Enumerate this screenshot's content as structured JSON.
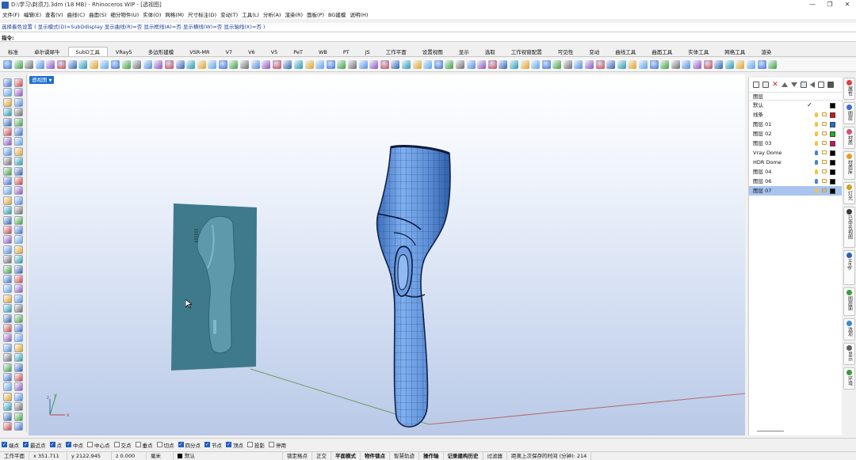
{
  "window": {
    "title": "D:\\学习\\剃须刀.3dm (18 MB) - Rhinoceros WIP - [透视图]",
    "buttons": [
      "—",
      "❐",
      "✕"
    ]
  },
  "menu": [
    "文件(F)",
    "编辑(E)",
    "查看(V)",
    "曲线(C)",
    "曲面(S)",
    "细分物件(U)",
    "实体(O)",
    "网格(M)",
    "尺寸标注(D)",
    "变动(T)",
    "工具(L)",
    "分析(A)",
    "渲染(R)",
    "面板(P)",
    "BG建模",
    "说明(H)"
  ],
  "command": {
    "history": "选择着色设置 ( 显示模式(D)=SubDdisplay  显示曲线(R)=否  显示框线(A)=否  显示横线(W)=否  显示轴线(X)=否 )",
    "prompt_label": "指令:",
    "value": ""
  },
  "tabs": [
    "标准",
    "卓尔谟犀牛",
    "SubD工具",
    "VRay5",
    "多边形建模",
    "VSR-MR",
    "V7",
    "V6",
    "V5",
    "PeT",
    "WB",
    "PT",
    "JS",
    "工作平面",
    "设置视图",
    "显示",
    "选取",
    "工作视窗配置",
    "可见性",
    "变动",
    "曲线工具",
    "曲面工具",
    "实体工具",
    "网格工具",
    "渲染"
  ],
  "active_tab_index": 2,
  "viewport": {
    "label": "透视图",
    "background_colors": [
      "#ffffff",
      "#b9c9e7"
    ],
    "model_color": "#5d8fd8",
    "image_color": "#3f7a8c"
  },
  "layers_panel": {
    "header": "图层",
    "layers": [
      {
        "name": "默认",
        "current": true,
        "color": "#000000",
        "bulb": "#f2c53d"
      },
      {
        "name": "线条",
        "current": false,
        "color": "#e01010",
        "bulb": "#f2c53d"
      },
      {
        "name": "图层 01",
        "current": false,
        "color": "#1f6fd0",
        "bulb": "#f2c53d"
      },
      {
        "name": "图层 02",
        "current": false,
        "color": "#20b020",
        "bulb": "#f2c53d"
      },
      {
        "name": "图层 03",
        "current": false,
        "color": "#d01070",
        "bulb": "#f2c53d"
      },
      {
        "name": "Vray Dome",
        "current": false,
        "color": "#000000",
        "bulb": "#4a7fd0"
      },
      {
        "name": "HDR Dome",
        "current": false,
        "color": "#000000",
        "bulb": "#4a7fd0"
      },
      {
        "name": "图层 04",
        "current": false,
        "color": "#000000",
        "bulb": "#f2c53d"
      },
      {
        "name": "图层 06",
        "current": false,
        "color": "#000000",
        "bulb": "#4a7fd0"
      },
      {
        "name": "图层 07",
        "current": false,
        "color": "#000000",
        "bulb": "#f2c53d",
        "selected": true
      }
    ]
  },
  "side_tabs": [
    "属性",
    "图层",
    "材质",
    "材质库",
    "灯光",
    "已命名视图",
    "Help",
    "图层面",
    "选项",
    "显示",
    "环境"
  ],
  "osnaps": [
    {
      "label": "端点",
      "on": true
    },
    {
      "label": "最近点",
      "on": true
    },
    {
      "label": "点",
      "on": true
    },
    {
      "label": "中点",
      "on": true
    },
    {
      "label": "中心点",
      "on": false
    },
    {
      "label": "交点",
      "on": false
    },
    {
      "label": "垂点",
      "on": false
    },
    {
      "label": "切点",
      "on": false
    },
    {
      "label": "四分点",
      "on": true
    },
    {
      "label": "节点",
      "on": true
    },
    {
      "label": "顶点",
      "on": true
    },
    {
      "label": "投影",
      "on": false
    },
    {
      "label": "停用",
      "on": false
    }
  ],
  "status": {
    "cplane": "工作平面",
    "x": "x 351.711",
    "y": "y 2122.945",
    "z": "z 0.000",
    "units": "毫米",
    "layer": "默认",
    "toggles": [
      "锁定格点",
      "正交",
      "平面模式",
      "物件锁点",
      "智慧轨迹",
      "操作轴",
      "记录建构历史",
      "过滤器"
    ],
    "bold_toggles": [
      "平面模式",
      "物件锁点",
      "操作轴",
      "记录建构历史"
    ],
    "autosave": "距离上次保存的时间 (分钟): 214"
  }
}
